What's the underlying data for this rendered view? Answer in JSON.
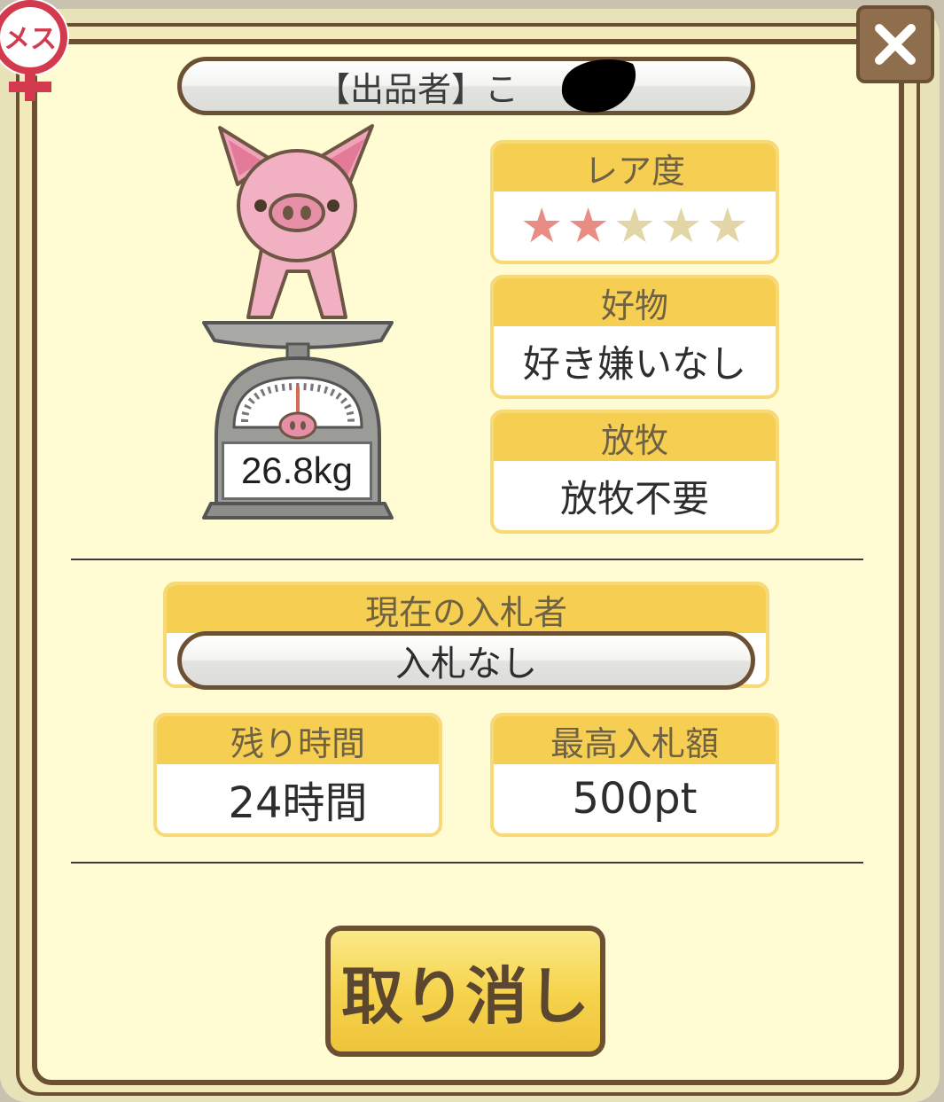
{
  "header": {
    "seller_text": "【出品者】こ"
  },
  "gender_badge": {
    "label": "メス",
    "icon": "female-symbol-icon"
  },
  "close_button": {
    "icon": "close-icon"
  },
  "pig": {
    "weight": "26.8kg"
  },
  "rarity": {
    "title": "レア度",
    "filled": 2,
    "total": 5,
    "filled_color": "#e98c83",
    "empty_color": "#e2d6a6",
    "star_glyph": "★"
  },
  "liking": {
    "title": "好物",
    "value": "好き嫌いなし"
  },
  "grazing": {
    "title": "放牧",
    "value": "放牧不要"
  },
  "bidder": {
    "title": "現在の入札者",
    "value": "入札なし"
  },
  "time_left": {
    "title": "残り時間",
    "value": "24時間"
  },
  "max_bid": {
    "title": "最高入札額",
    "value": "500pt"
  },
  "actions": {
    "cancel_label": "取り消し"
  },
  "colors": {
    "frame_brown": "#6c5034",
    "panel_bg": "#fffbd2",
    "card_header": "#f6cf52",
    "button_yellow": "#f6d44e"
  }
}
